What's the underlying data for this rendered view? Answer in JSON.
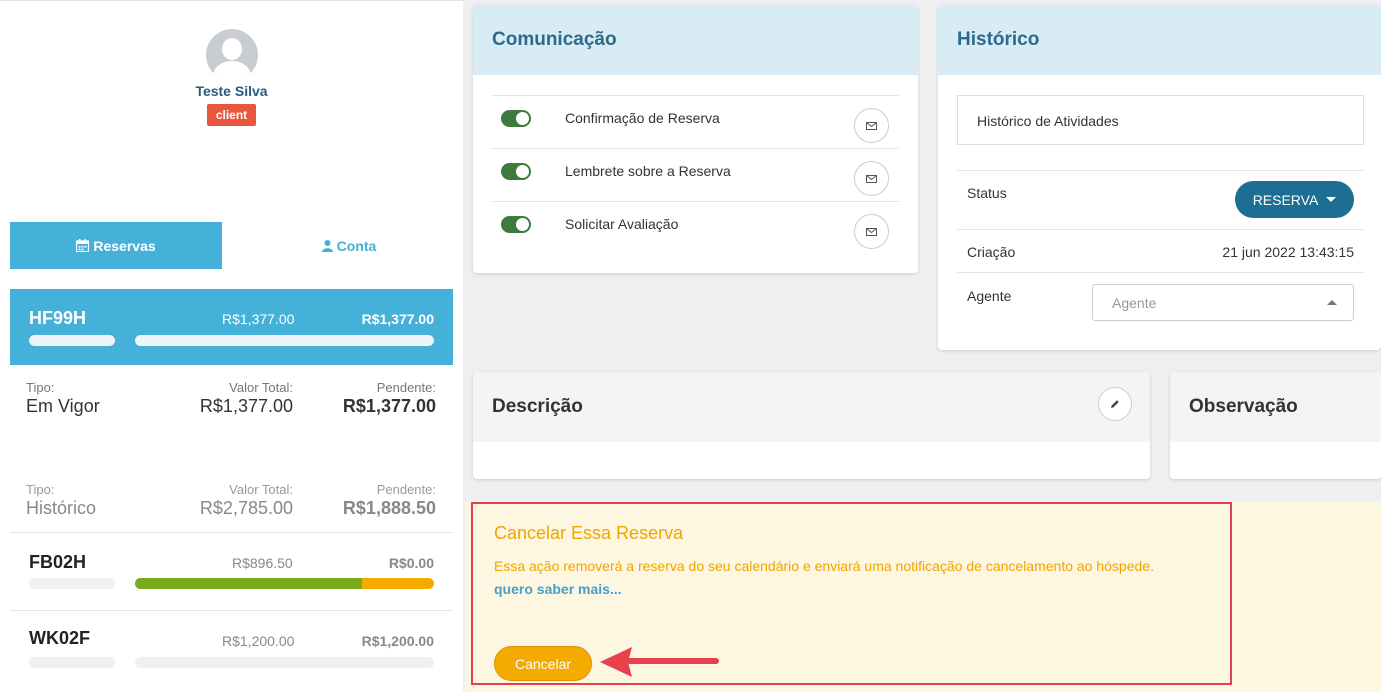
{
  "user": {
    "name": "Teste Silva",
    "role": "client"
  },
  "tabs": {
    "reservas": "Reservas",
    "conta": "Conta"
  },
  "active_reservation": {
    "code": "HF99H",
    "total": "R$1,377.00",
    "pending": "R$1,377.00"
  },
  "summary_current": {
    "type_label": "Tipo:",
    "type_value": "Em Vigor",
    "total_label": "Valor Total:",
    "total_value": "R$1,377.00",
    "pending_label": "Pendente:",
    "pending_value": "R$1,377.00"
  },
  "summary_history": {
    "type_label": "Tipo:",
    "type_value": "Histórico",
    "total_label": "Valor Total:",
    "total_value": "R$2,785.00",
    "pending_label": "Pendente:",
    "pending_value": "R$1,888.50"
  },
  "reservations": [
    {
      "code": "FB02H",
      "total": "R$896.50",
      "pending": "R$0.00",
      "paid_fraction": 0.76
    },
    {
      "code": "WK02F",
      "total": "R$1,200.00",
      "pending": "R$1,200.00",
      "paid_fraction": 0
    }
  ],
  "communication": {
    "title": "Comunicação",
    "items": [
      {
        "label": "Confirmação de Reserva",
        "enabled": true
      },
      {
        "label": "Lembrete sobre a Reserva",
        "enabled": true
      },
      {
        "label": "Solicitar Avaliação",
        "enabled": true
      }
    ]
  },
  "history": {
    "title": "Histórico",
    "activity_link": "Histórico de Atividades",
    "status_label": "Status",
    "status_value": "RESERVA",
    "created_label": "Criação",
    "created_value": "21 jun 2022 13:43:15",
    "agent_label": "Agente",
    "agent_placeholder": "Agente"
  },
  "description": {
    "title": "Descrição"
  },
  "observation": {
    "title": "Observação"
  },
  "cancel": {
    "title": "Cancelar Essa Reserva",
    "text": "Essa ação removerá a reserva do seu calendário e enviará uma notificação de cancelamento ao hóspede.",
    "link": "quero saber mais...",
    "button": "Cancelar"
  },
  "colors": {
    "accent": "#45b0d8",
    "warning": "#f5aa00",
    "danger": "#e04050",
    "success": "#7aab1f"
  }
}
